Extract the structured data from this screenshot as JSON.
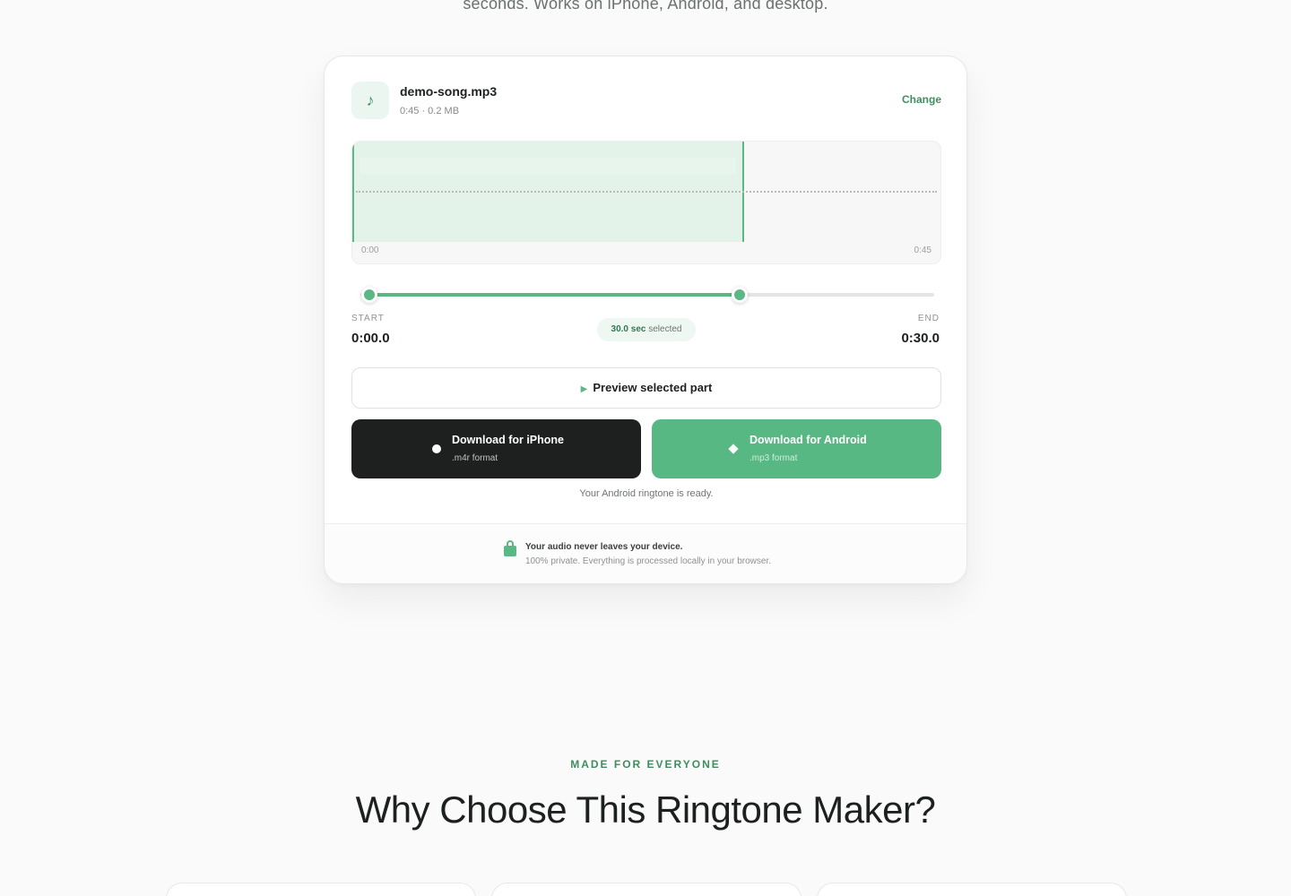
{
  "hero": {
    "subtitle_tail": "seconds. Works on iPhone, Android, and desktop."
  },
  "file": {
    "icon": "music-note-icon",
    "name": "demo-song.mp3",
    "meta": "0:45 · 0.2 MB",
    "change_label": "Change"
  },
  "waveform": {
    "start_time": "0:00",
    "end_time": "0:45",
    "duration_seconds": 45,
    "selection_start_seconds": 0,
    "selection_end_seconds": 30
  },
  "range": {
    "start_label": "START",
    "start_value": "0:00.0",
    "end_label": "END",
    "end_value": "0:30.0",
    "selected_value": "30.0 sec",
    "selected_suffix": "selected"
  },
  "preview": {
    "label": "Preview selected part",
    "icon": "play-icon"
  },
  "downloads": {
    "iphone": {
      "title": "Download for iPhone",
      "subtitle": ".m4r format",
      "icon": "apple-dot-icon"
    },
    "android": {
      "title": "Download for Android",
      "subtitle": ".mp3 format",
      "icon": "android-diamond-icon"
    }
  },
  "status": "Your Android ringtone is ready.",
  "privacy": {
    "icon": "lock-icon",
    "title": "Your audio never leaves your device.",
    "subtitle": "100% private. Everything is processed locally in your browser."
  },
  "section": {
    "eyebrow": "MADE FOR EVERYONE",
    "title": "Why Choose This Ringtone Maker?"
  },
  "colors": {
    "accent": "#58b884",
    "accent_dark": "#3e8e5f",
    "dark_button": "#1d201f"
  }
}
